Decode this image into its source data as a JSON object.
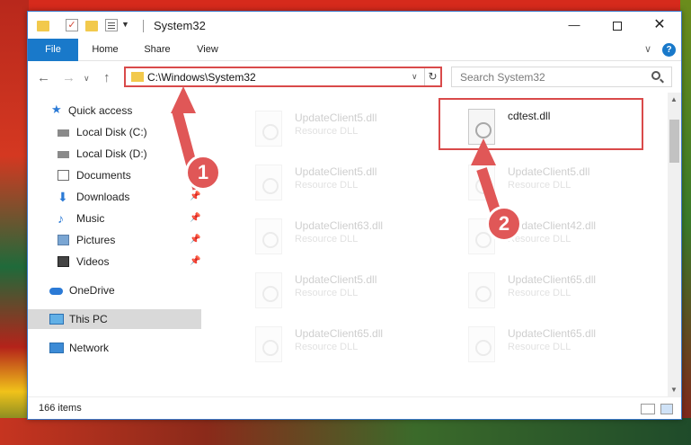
{
  "window": {
    "title": "System32"
  },
  "ribbon": {
    "tabs": [
      "File",
      "Home",
      "Share",
      "View"
    ]
  },
  "nav": {
    "address": "C:\\Windows\\System32",
    "search_placeholder": "Search System32"
  },
  "sidebar": {
    "items": [
      {
        "label": "Quick access",
        "icon": "star-icon"
      },
      {
        "label": "Local Disk (C:)",
        "icon": "drive-icon"
      },
      {
        "label": "Local Disk (D:)",
        "icon": "drive-icon"
      },
      {
        "label": "Documents",
        "icon": "documents-icon"
      },
      {
        "label": "Downloads",
        "icon": "download-icon"
      },
      {
        "label": "Music",
        "icon": "music-icon"
      },
      {
        "label": "Pictures",
        "icon": "pictures-icon"
      },
      {
        "label": "Videos",
        "icon": "videos-icon"
      },
      {
        "label": "OneDrive",
        "icon": "cloud-icon"
      },
      {
        "label": "This PC",
        "icon": "computer-icon"
      },
      {
        "label": "Network",
        "icon": "network-icon"
      }
    ]
  },
  "files": [
    {
      "name": "UpdateClient5.dll",
      "type": "Resource DLL"
    },
    {
      "name": "cdtest.dll",
      "type": ""
    },
    {
      "name": "UpdateClient5.dll",
      "type": "Resource DLL"
    },
    {
      "name": "UpdateClient5.dll",
      "type": "Resource DLL"
    },
    {
      "name": "UpdateClient63.dll",
      "type": "Resource DLL"
    },
    {
      "name": "UpdateClient42.dll",
      "type": "Resource DLL"
    },
    {
      "name": "UpdateClient5.dll",
      "type": "Resource DLL"
    },
    {
      "name": "UpdateClient65.dll",
      "type": "Resource DLL"
    },
    {
      "name": "UpdateClient65.dll",
      "type": "Resource DLL"
    },
    {
      "name": "UpdateClient65.dll",
      "type": "Resource DLL"
    }
  ],
  "status": {
    "item_count": "166 items"
  },
  "annotations": {
    "step1": "1",
    "step2": "2",
    "color": "#e05757"
  }
}
